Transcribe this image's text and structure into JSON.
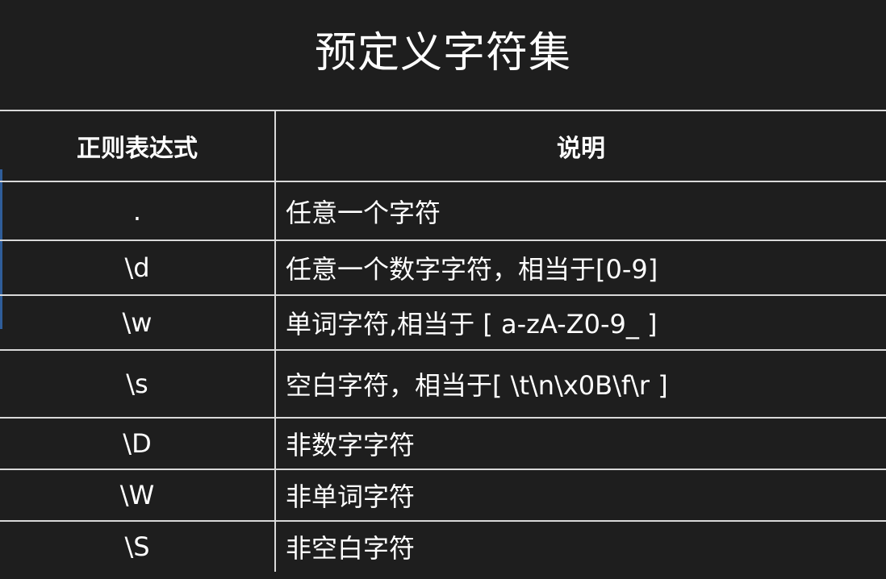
{
  "title": "预定义字符集",
  "table": {
    "headers": [
      "正则表达式",
      "说明"
    ],
    "rows": [
      {
        "expr": ".",
        "desc": "任意一个字符"
      },
      {
        "expr": "\\d",
        "desc": "任意一个数字字符，相当于[0-9]"
      },
      {
        "expr": "\\w",
        "desc": "单词字符,相当于 [ a-zA-Z0-9_ ]"
      },
      {
        "expr": "\\s",
        "desc": "空白字符，相当于[ \\t\\n\\x0B\\f\\r ]"
      },
      {
        "expr": "\\D",
        "desc": "非数字字符"
      },
      {
        "expr": "\\W",
        "desc": "非单词字符"
      },
      {
        "expr": "\\S",
        "desc": "非空白字符"
      }
    ]
  }
}
